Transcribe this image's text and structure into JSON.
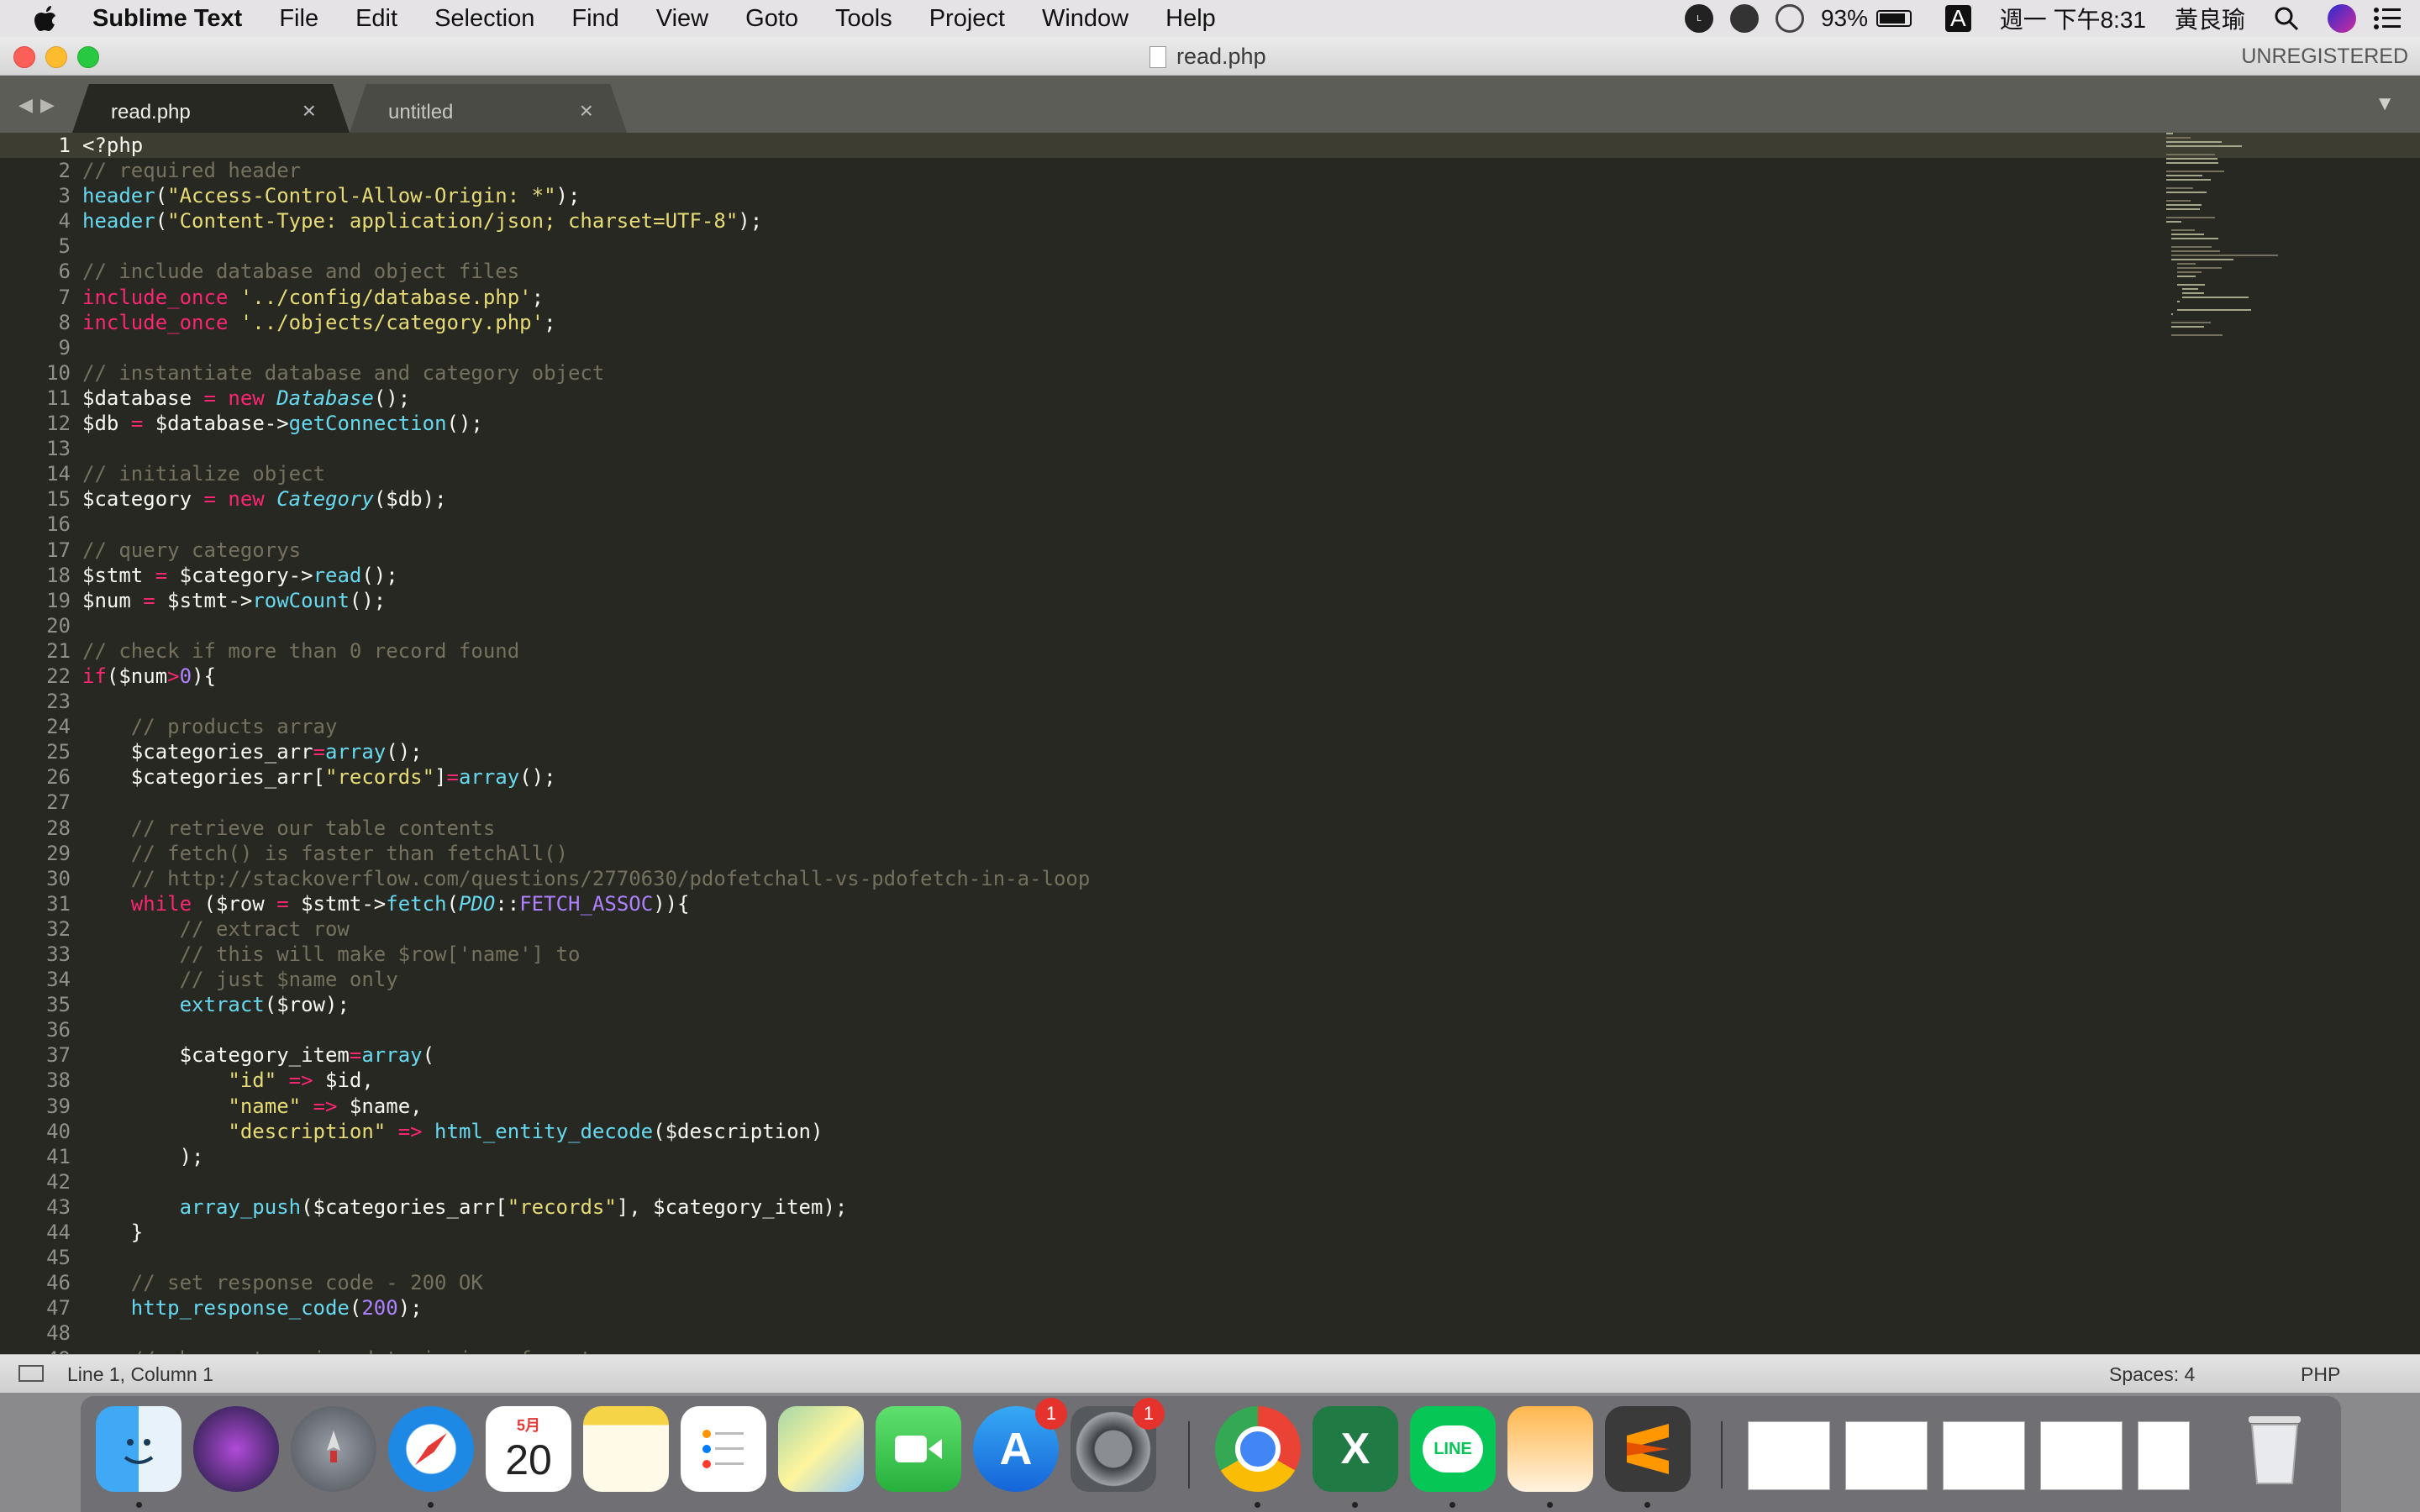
{
  "menubar": {
    "app_name": "Sublime Text",
    "items": [
      "File",
      "Edit",
      "Selection",
      "Find",
      "View",
      "Goto",
      "Tools",
      "Project",
      "Window",
      "Help"
    ],
    "battery": "93%",
    "input_method": "A",
    "clock": "週一 下午8:31",
    "user": "黃良瑜"
  },
  "window": {
    "title": "read.php",
    "license_status": "UNREGISTERED"
  },
  "tabs": [
    {
      "label": "read.php",
      "active": true
    },
    {
      "label": "untitled",
      "active": false
    }
  ],
  "tab_close_glyph": "×",
  "editor": {
    "lines": [
      "<?php",
      "// required header",
      "header(\"Access-Control-Allow-Origin: *\");",
      "header(\"Content-Type: application/json; charset=UTF-8\");",
      "",
      "// include database and object files",
      "include_once '../config/database.php';",
      "include_once '../objects/category.php';",
      "",
      "// instantiate database and category object",
      "$database = new Database();",
      "$db = $database->getConnection();",
      "",
      "// initialize object",
      "$category = new Category($db);",
      "",
      "// query categorys",
      "$stmt = $category->read();",
      "$num = $stmt->rowCount();",
      "",
      "// check if more than 0 record found",
      "if($num>0){",
      "",
      "    // products array",
      "    $categories_arr=array();",
      "    $categories_arr[\"records\"]=array();",
      "",
      "    // retrieve our table contents",
      "    // fetch() is faster than fetchAll()",
      "    // http://stackoverflow.com/questions/2770630/pdofetchall-vs-pdofetch-in-a-loop",
      "    while ($row = $stmt->fetch(PDO::FETCH_ASSOC)){",
      "        // extract row",
      "        // this will make $row['name'] to",
      "        // just $name only",
      "        extract($row);",
      "",
      "        $category_item=array(",
      "            \"id\" => $id,",
      "            \"name\" => $name,",
      "            \"description\" => html_entity_decode($description)",
      "        );",
      "",
      "        array_push($categories_arr[\"records\"], $category_item);",
      "    }",
      "",
      "    // set response code - 200 OK",
      "    http_response_code(200);",
      "",
      "    // show categories data in json format"
    ]
  },
  "status": {
    "position": "Line 1, Column 1",
    "indentation": "Spaces: 4",
    "syntax": "PHP"
  },
  "dock": {
    "calendar_month": "5月",
    "calendar_day": "20",
    "app_store_badge": "1",
    "system_prefs_badge": "1",
    "line_label": "LINE"
  }
}
